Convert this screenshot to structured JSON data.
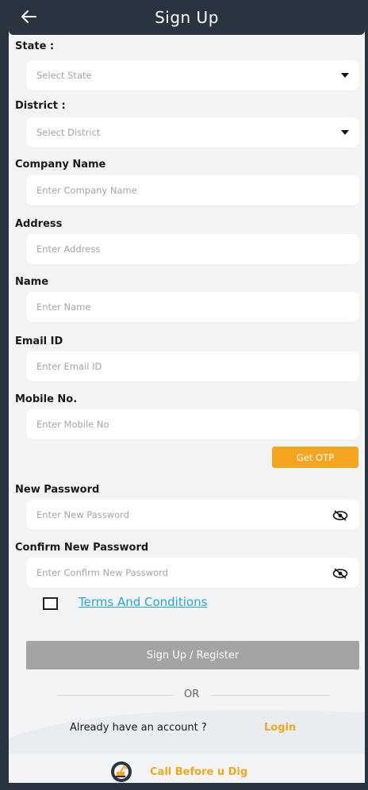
{
  "header": {
    "title": "Sign Up"
  },
  "fields": {
    "state": {
      "label": "State :",
      "placeholder": "Select State"
    },
    "district": {
      "label": "District :",
      "placeholder": "Select District"
    },
    "company": {
      "label": "Company Name",
      "placeholder": "Enter Company Name"
    },
    "address": {
      "label": "Address",
      "placeholder": "Enter Address"
    },
    "name": {
      "label": "Name",
      "placeholder": "Enter Name"
    },
    "email": {
      "label": "Email ID",
      "placeholder": "Enter Email ID"
    },
    "mobile": {
      "label": "Mobile No.",
      "placeholder": "Enter Mobile No"
    },
    "password": {
      "label": "New Password",
      "placeholder": "Enter New Password"
    },
    "confirm": {
      "label": "Confirm New Password",
      "placeholder": "Enter Confirm New Password"
    }
  },
  "otp_label": "Get OTP",
  "terms_label": "Terms And Conditions",
  "signup_label": "Sign Up / Register",
  "or_label": "OR",
  "already_text": "Already have an account ?",
  "login_label": "Login",
  "footer_brand": "Call Before u Dig",
  "colors": {
    "header": "#2a3340",
    "accent": "#f4a620",
    "link": "#2aa3d6",
    "disabled_button": "#a4a4a4"
  },
  "icons": {
    "back": "arrow-left-icon",
    "dropdown": "caret-down-icon",
    "visibility": "eye-off-icon"
  }
}
